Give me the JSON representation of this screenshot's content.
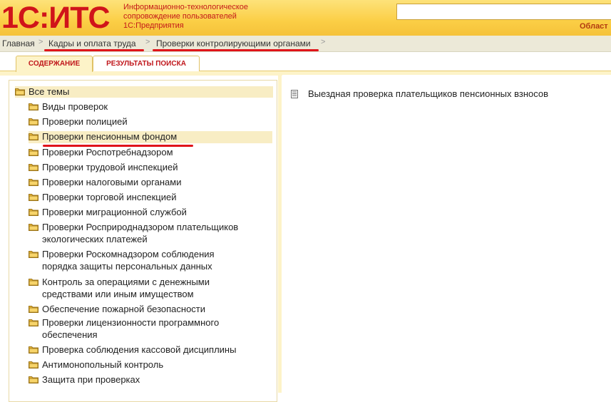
{
  "header": {
    "logo_text": "1С:ИТС",
    "tagline_lines": [
      "Информационно-технологическое",
      "сопровождение пользователей",
      "1С:Предприятия"
    ],
    "search_value": "",
    "region_label": "Област"
  },
  "breadcrumb": {
    "items": [
      "Главная",
      "Кадры и оплата труда",
      "Проверки контролирующими органами"
    ],
    "separator": ">"
  },
  "tabs": [
    {
      "label": "СОДЕРЖАНИЕ",
      "active": true
    },
    {
      "label": "РЕЗУЛЬТАТЫ ПОИСКА",
      "active": false
    }
  ],
  "tree": {
    "root": "Все темы",
    "items": [
      {
        "lines": [
          "Виды проверок"
        ]
      },
      {
        "lines": [
          "Проверки полицией"
        ]
      },
      {
        "lines": [
          "Проверки пенсионным фондом"
        ],
        "selected": true
      },
      {
        "lines": [
          "Проверки Роспотребнадзором"
        ]
      },
      {
        "lines": [
          "Проверки трудовой инспекцией"
        ]
      },
      {
        "lines": [
          "Проверки налоговыми органами"
        ]
      },
      {
        "lines": [
          "Проверки торговой инспекцией"
        ]
      },
      {
        "lines": [
          "Проверки миграционной службой"
        ]
      },
      {
        "lines": [
          "Проверки Росприроднадзором плательщиков",
          "экологических платежей"
        ]
      },
      {
        "lines": [
          "Проверки Роскомнадзором соблюдения",
          "порядка защиты персональных данных"
        ]
      },
      {
        "lines": [
          "Контроль за операциями с денежными",
          "средствами или иным имуществом"
        ]
      },
      {
        "lines": [
          "Обеспечение пожарной безопасности"
        ]
      },
      {
        "lines": [
          "Проверки лицензионности программного",
          "обеспечения"
        ]
      },
      {
        "lines": [
          "Проверка соблюдения кассовой дисциплины"
        ]
      },
      {
        "lines": [
          "Антимонопольный контроль"
        ]
      },
      {
        "lines": [
          "Защита при проверках"
        ]
      }
    ]
  },
  "documents": [
    {
      "label": "Выездная проверка плательщиков пенсионных взносов"
    }
  ],
  "colors": {
    "brand_red": "#d0141a",
    "header_yellow": "#fbce45",
    "selection": "#f8edc4"
  }
}
